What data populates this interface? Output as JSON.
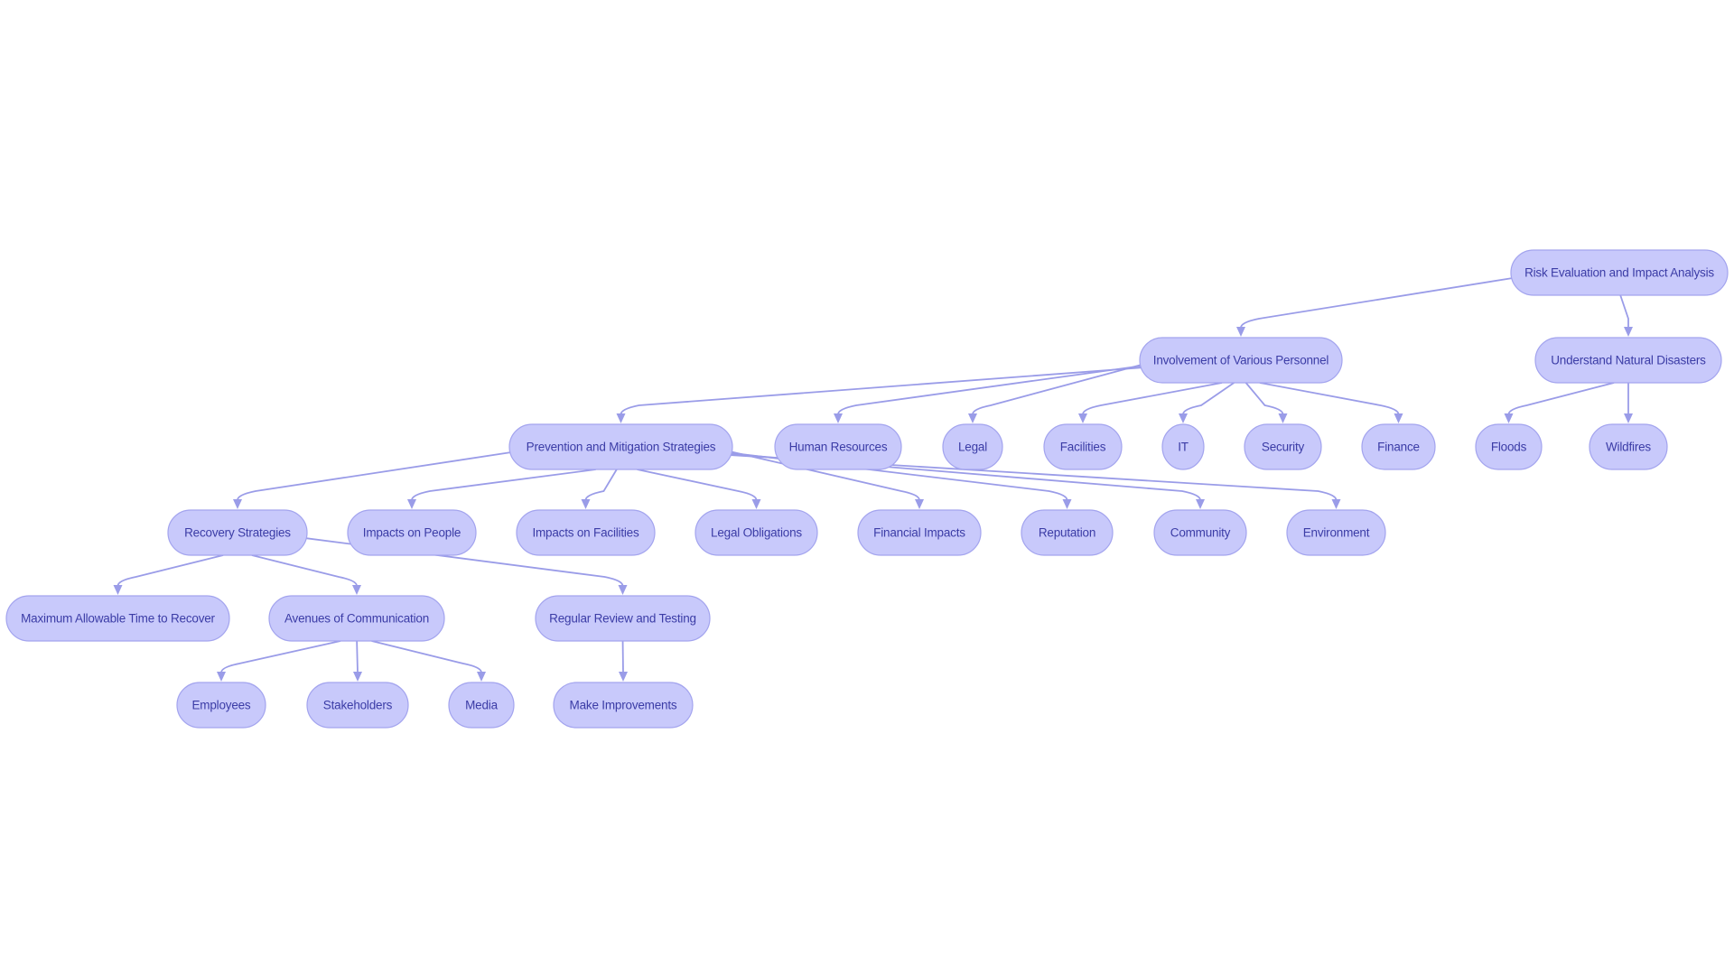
{
  "diagram": {
    "type": "flowchart",
    "direction": "top-down",
    "colors": {
      "node_fill": "#c8c9fb",
      "node_stroke": "#a3a4ee",
      "node_text": "#3b3ca6",
      "edge": "#9a9ce8",
      "background": "#ffffff"
    },
    "nodes": [
      {
        "id": "risk",
        "label": "Risk Evaluation and Impact Analysis"
      },
      {
        "id": "involvement",
        "label": "Involvement of Various Personnel"
      },
      {
        "id": "natural",
        "label": "Understand Natural Disasters"
      },
      {
        "id": "prevention",
        "label": "Prevention and Mitigation Strategies"
      },
      {
        "id": "hr",
        "label": "Human Resources"
      },
      {
        "id": "legal",
        "label": "Legal"
      },
      {
        "id": "facilities",
        "label": "Facilities"
      },
      {
        "id": "it",
        "label": "IT"
      },
      {
        "id": "security",
        "label": "Security"
      },
      {
        "id": "finance",
        "label": "Finance"
      },
      {
        "id": "floods",
        "label": "Floods"
      },
      {
        "id": "wildfires",
        "label": "Wildfires"
      },
      {
        "id": "recovery",
        "label": "Recovery Strategies"
      },
      {
        "id": "people",
        "label": "Impacts on People"
      },
      {
        "id": "impfacilities",
        "label": "Impacts on Facilities"
      },
      {
        "id": "legalobl",
        "label": "Legal Obligations"
      },
      {
        "id": "financial",
        "label": "Financial Impacts"
      },
      {
        "id": "reputation",
        "label": "Reputation"
      },
      {
        "id": "community",
        "label": "Community"
      },
      {
        "id": "environment",
        "label": "Environment"
      },
      {
        "id": "maxtime",
        "label": "Maximum Allowable Time to Recover"
      },
      {
        "id": "avenues",
        "label": "Avenues of Communication"
      },
      {
        "id": "review",
        "label": "Regular Review and Testing"
      },
      {
        "id": "employees",
        "label": "Employees"
      },
      {
        "id": "stakeholders",
        "label": "Stakeholders"
      },
      {
        "id": "media",
        "label": "Media"
      },
      {
        "id": "improvements",
        "label": "Make Improvements"
      }
    ],
    "edges": [
      {
        "from": "risk",
        "to": "involvement"
      },
      {
        "from": "risk",
        "to": "natural"
      },
      {
        "from": "involvement",
        "to": "prevention"
      },
      {
        "from": "involvement",
        "to": "hr"
      },
      {
        "from": "involvement",
        "to": "legal"
      },
      {
        "from": "involvement",
        "to": "facilities"
      },
      {
        "from": "involvement",
        "to": "it"
      },
      {
        "from": "involvement",
        "to": "security"
      },
      {
        "from": "involvement",
        "to": "finance"
      },
      {
        "from": "natural",
        "to": "floods"
      },
      {
        "from": "natural",
        "to": "wildfires"
      },
      {
        "from": "prevention",
        "to": "recovery"
      },
      {
        "from": "prevention",
        "to": "people"
      },
      {
        "from": "prevention",
        "to": "impfacilities"
      },
      {
        "from": "prevention",
        "to": "legalobl"
      },
      {
        "from": "prevention",
        "to": "financial"
      },
      {
        "from": "prevention",
        "to": "reputation"
      },
      {
        "from": "prevention",
        "to": "community"
      },
      {
        "from": "prevention",
        "to": "environment"
      },
      {
        "from": "recovery",
        "to": "maxtime"
      },
      {
        "from": "recovery",
        "to": "avenues"
      },
      {
        "from": "recovery",
        "to": "review"
      },
      {
        "from": "avenues",
        "to": "employees"
      },
      {
        "from": "avenues",
        "to": "stakeholders"
      },
      {
        "from": "avenues",
        "to": "media"
      },
      {
        "from": "review",
        "to": "improvements"
      }
    ]
  }
}
